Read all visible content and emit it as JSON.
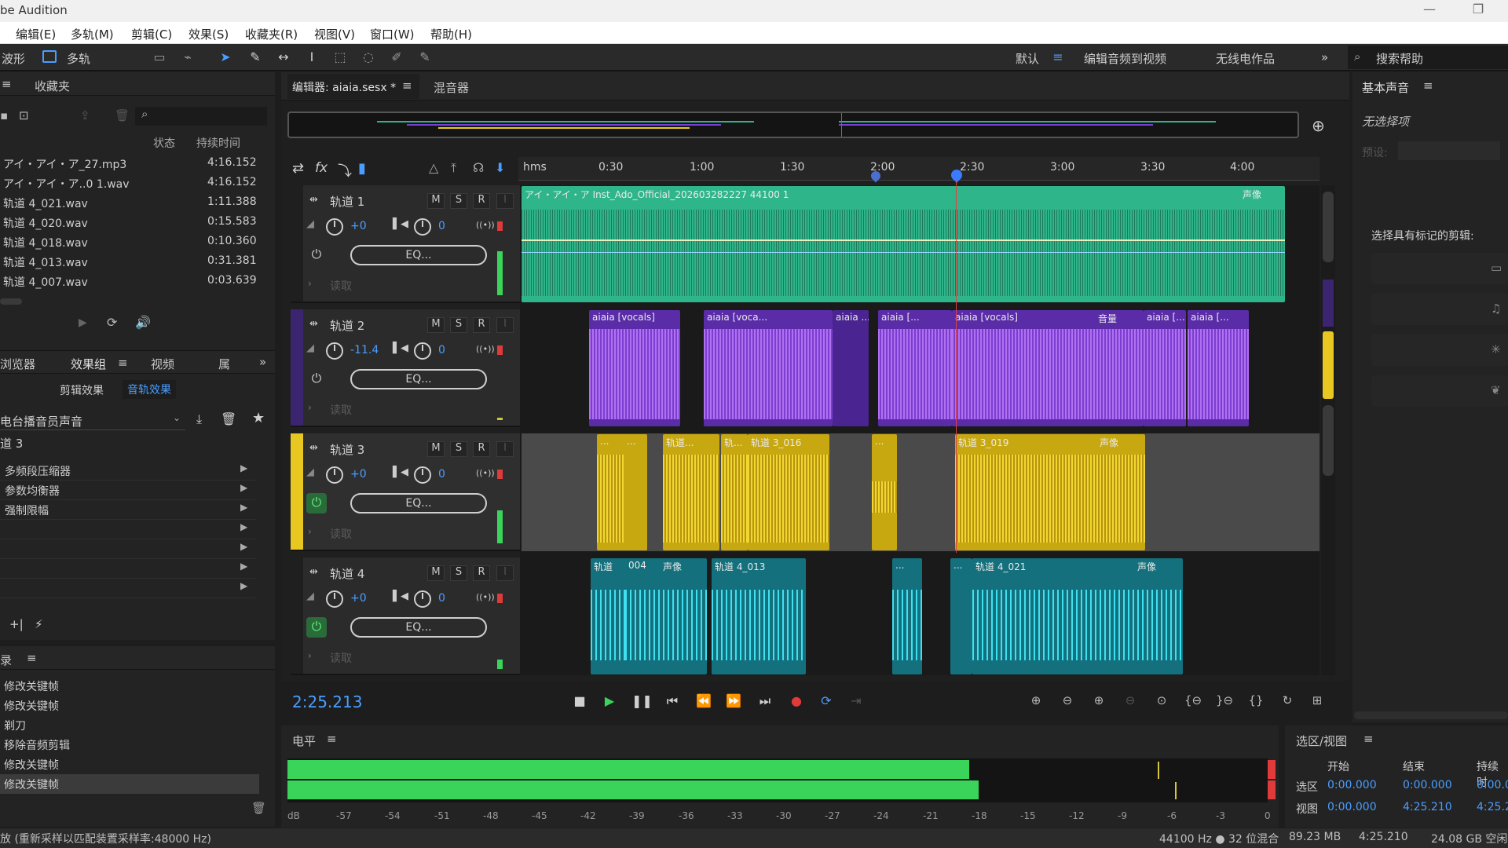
{
  "window": {
    "title": "be Audition",
    "min": "—",
    "max": "❐"
  },
  "menu": [
    "编辑(E)",
    "多轨(M)",
    "剪辑(C)",
    "效果(S)",
    "收藏夹(R)",
    "视图(V)",
    "窗口(W)",
    "帮助(H)"
  ],
  "toolbar": {
    "waveform": "波形",
    "multitrack": "多轨",
    "workspaces": [
      "默认",
      "编辑音频到视频",
      "无线电作品"
    ],
    "more": "»",
    "search_placeholder": "搜索帮助"
  },
  "files_panel": {
    "tab": "收藏夹",
    "col_status": "状态",
    "col_duration": "持续时间",
    "files": [
      {
        "name": "アイ・アイ・ア_27.mp3",
        "duration": "4:16.152"
      },
      {
        "name": "アイ・アイ・ア..0 1.wav",
        "duration": "4:16.152"
      },
      {
        "name": "轨道 4_021.wav",
        "duration": "1:11.388"
      },
      {
        "name": "轨道 4_020.wav",
        "duration": "0:15.583"
      },
      {
        "name": "轨道 4_018.wav",
        "duration": "0:10.360"
      },
      {
        "name": "轨道 4_013.wav",
        "duration": "0:31.381"
      },
      {
        "name": "轨道 4_007.wav",
        "duration": "0:03.639"
      }
    ]
  },
  "effects_panel": {
    "tabs": [
      "浏览器",
      "效果组",
      "视频",
      "属"
    ],
    "subtabs": [
      "剪辑效果",
      "音轨效果"
    ],
    "preset": "电台播音员声音",
    "track_label": "道 3",
    "effects": [
      "多频段压缩器",
      "参数均衡器",
      "强制限幅",
      "",
      "",
      "",
      ""
    ]
  },
  "history_panel": {
    "title": "录",
    "items": [
      "修改关键帧",
      "修改关键帧",
      "剃刀",
      "移除音频剪辑",
      "修改关键帧",
      "修改关键帧"
    ]
  },
  "editor": {
    "tab_editor": "编辑器: aiaia.sesx *",
    "tab_mixer": "混音器",
    "ruler_unit": "hms",
    "ruler": [
      "0:30",
      "1:00",
      "1:30",
      "2:00",
      "2:30",
      "3:00",
      "3:30",
      "4:00"
    ],
    "time": "2:25.213",
    "read_label": "读取",
    "eq_label": "EQ...",
    "tracks": [
      {
        "name": "轨道 1",
        "vol": "+0",
        "pan": "0",
        "color": "#2fb58a"
      },
      {
        "name": "轨道 2",
        "vol": "-11.4",
        "pan": "0",
        "color": "#7a3fd0"
      },
      {
        "name": "轨道 3",
        "vol": "+0",
        "pan": "0",
        "color": "#e8c820"
      },
      {
        "name": "轨道 4",
        "vol": "+0",
        "pan": "0",
        "color": "#1d9aa8"
      }
    ],
    "clips": {
      "t1": "アイ・アイ・ア Inst_Ado_Official_202603282227 44100 1",
      "t1_right": "声像",
      "t2": [
        "aiaia [vocals]",
        "aiaia [voca...",
        "aiaia ...",
        "aiaia [...",
        "aiaia [vocals]",
        "音量",
        "aiaia [...",
        "aiaia [..."
      ],
      "t3": [
        "...",
        "...",
        "轨道...",
        "轨...",
        "轨道 3_016",
        "...",
        "轨道 3_019",
        "声像"
      ],
      "t4": [
        "轨道",
        "004",
        "声像",
        "轨道 4_013",
        "...",
        "...",
        "轨道 4_021",
        "声像"
      ]
    }
  },
  "levels": {
    "title": "电平",
    "db_labels": [
      "dB",
      "-57",
      "-54",
      "-51",
      "-48",
      "-45",
      "-42",
      "-39",
      "-36",
      "-33",
      "-30",
      "-27",
      "-24",
      "-21",
      "-18",
      "-15",
      "-12",
      "-9",
      "-6",
      "-3",
      "0"
    ],
    "left_level": 0.7,
    "right_level": 0.71
  },
  "essential_sound": {
    "title": "基本声音",
    "no_selection": "无选择项",
    "preset_label": "预设:",
    "marked_clips": "选择具有标记的剪辑:"
  },
  "selection_view": {
    "title": "选区/视图",
    "col_start": "开始",
    "col_end": "结束",
    "col_duration": "持续时",
    "rows": [
      {
        "label": "选区",
        "start": "0:00.000",
        "end": "0:00.000",
        "duration": "0:00.0"
      },
      {
        "label": "视图",
        "start": "0:00.000",
        "end": "4:25.210",
        "duration": "4:25.2"
      }
    ]
  },
  "status_bar": {
    "left": "放 (重新采样以匹配装置采样率:48000 Hz)",
    "format": "44100 Hz ● 32 位混合",
    "size": "89.23 MB",
    "duration": "4:25.210",
    "free": "24.08 GB 空闲"
  }
}
